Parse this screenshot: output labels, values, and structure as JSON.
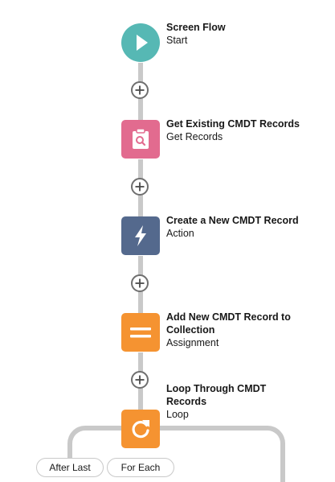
{
  "colors": {
    "start": "#56b8b4",
    "get_records": "#e26b8f",
    "action": "#54698d",
    "assignment": "#f59331",
    "loop": "#f59331",
    "connector": "#c9c9c9"
  },
  "nodes": [
    {
      "title": "Screen Flow",
      "type": "Start",
      "icon": "play-icon"
    },
    {
      "title": "Get Existing CMDT Records",
      "type": "Get Records",
      "icon": "clipboard-search-icon"
    },
    {
      "title": "Create a New CMDT Record",
      "type": "Action",
      "icon": "lightning-icon"
    },
    {
      "title": "Add New CMDT Record to Collection",
      "type": "Assignment",
      "icon": "equals-icon"
    },
    {
      "title": "Loop Through CMDT Records",
      "type": "Loop",
      "icon": "loop-icon"
    }
  ],
  "loop_branches": {
    "after_last": "After Last",
    "for_each": "For Each"
  }
}
